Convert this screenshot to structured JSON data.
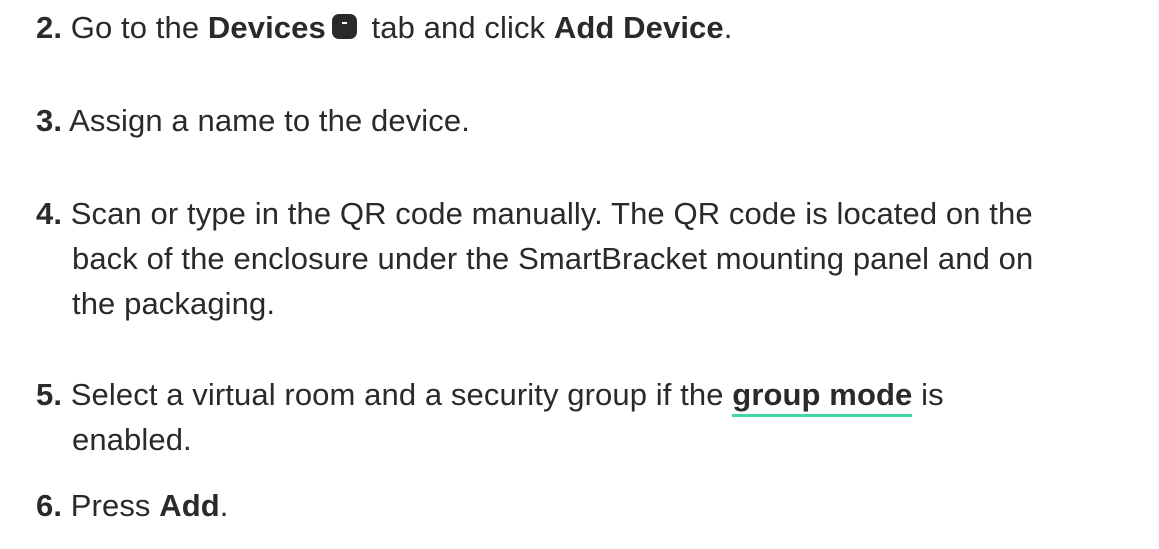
{
  "steps": [
    {
      "num": "2.",
      "t1": " Go to the ",
      "b1": "Devices",
      "icon": "devices-tab-icon",
      "t2": " tab and click ",
      "b2": "Add Device",
      "t3": "."
    },
    {
      "num": "3.",
      "t1": " Assign a name to the device."
    },
    {
      "num": "4.",
      "l1": " Scan or type in the QR code manually. The QR code is located on the",
      "l2": "back of the enclosure under the SmartBracket mounting panel and on",
      "l3": "the packaging."
    },
    {
      "num": "5.",
      "t1": " Select a virtual room and a security group if the ",
      "link": "group mode",
      "t2": " is",
      "l2": "enabled."
    },
    {
      "num": "6.",
      "t1": " Press ",
      "b1": "Add",
      "t2": "."
    }
  ],
  "colors": {
    "text": "#2a2a2a",
    "link_underline": "#3fd6a6"
  }
}
